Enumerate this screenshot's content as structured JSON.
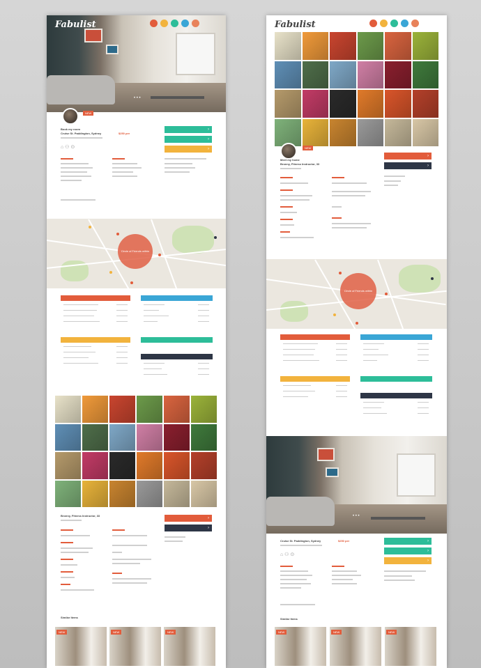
{
  "brand": {
    "name": "Fabulist"
  },
  "colors": {
    "red": "#e25c3b",
    "yellow": "#f2b33d",
    "green": "#2dbd99",
    "blue": "#3aa6d6",
    "navy": "#2e3646",
    "map_circle": "#e06046"
  },
  "social_icons": [
    "pinterest-icon",
    "instagram-icon",
    "facebook-icon",
    "twitter-icon",
    "google-plus-icon"
  ],
  "left": {
    "listing_title": "Book my room",
    "address": "Cruise St. Paddington, Sydney",
    "price": "$250 per",
    "gallery_title": "Bronny, Fitness Instructor, 33",
    "similar_title": "Similar Items",
    "tag": "NEW"
  },
  "right": {
    "listing_title": "Meet my home",
    "person": "Bronny, Fitness Instructor, 33",
    "address": "Cruise St. Paddington, Sydney",
    "price": "$250 per",
    "similar_title": "Similar Items",
    "tag": "NEW"
  },
  "map": {
    "circle_label": "Circle of Friends within"
  },
  "photo_grid": {
    "tiles": [
      "#e8e2c9",
      "#f09a3a",
      "#c9452f",
      "#6c9a4a",
      "#d9643f",
      "#9bb33a",
      "#5f8fb6",
      "#4f6e4a",
      "#7fa8c7",
      "#d07fa5",
      "#8a1f2e",
      "#3f7a3c",
      "#b59a6b",
      "#c23b66",
      "#2a2a2a",
      "#e07a2a",
      "#d9552a",
      "#b4402a",
      "#7fb27a",
      "#e8b33a",
      "#c8842f",
      "#9a9a9a",
      "#c5b89a",
      "#d8c7a6"
    ]
  }
}
